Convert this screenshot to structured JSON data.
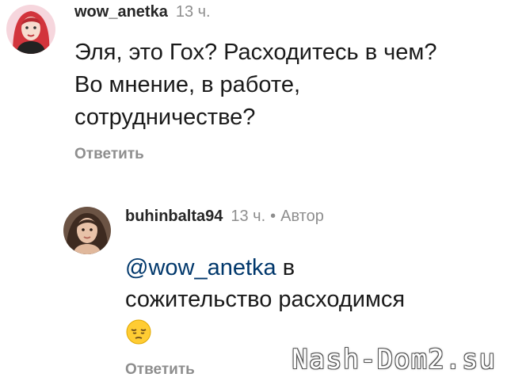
{
  "comments": [
    {
      "username": "wow_anetka",
      "time": "13 ч.",
      "text_lines": [
        "Эля, это Гох? Расходитесь в чем?",
        "Во мнение, в работе,",
        "сотрудничестве?"
      ],
      "reply_label": "Ответить",
      "avatar_icon": "avatar-red-hair-icon"
    },
    {
      "username": "buhinbalta94",
      "time": "13 ч.",
      "separator": "•",
      "badge": "Автор",
      "mention": "@wow_anetka",
      "text_after_mention": " в",
      "text_line2": "сожительство расходимся",
      "emoji_icon": "pensive-face-emoji",
      "reply_label": "Ответить",
      "avatar_icon": "avatar-woman-icon"
    }
  ],
  "watermark": "Nash-Dom2.su",
  "colors": {
    "mention": "#00376b",
    "secondary_text": "#8e8e8e",
    "primary_text": "#1a1a1a"
  }
}
